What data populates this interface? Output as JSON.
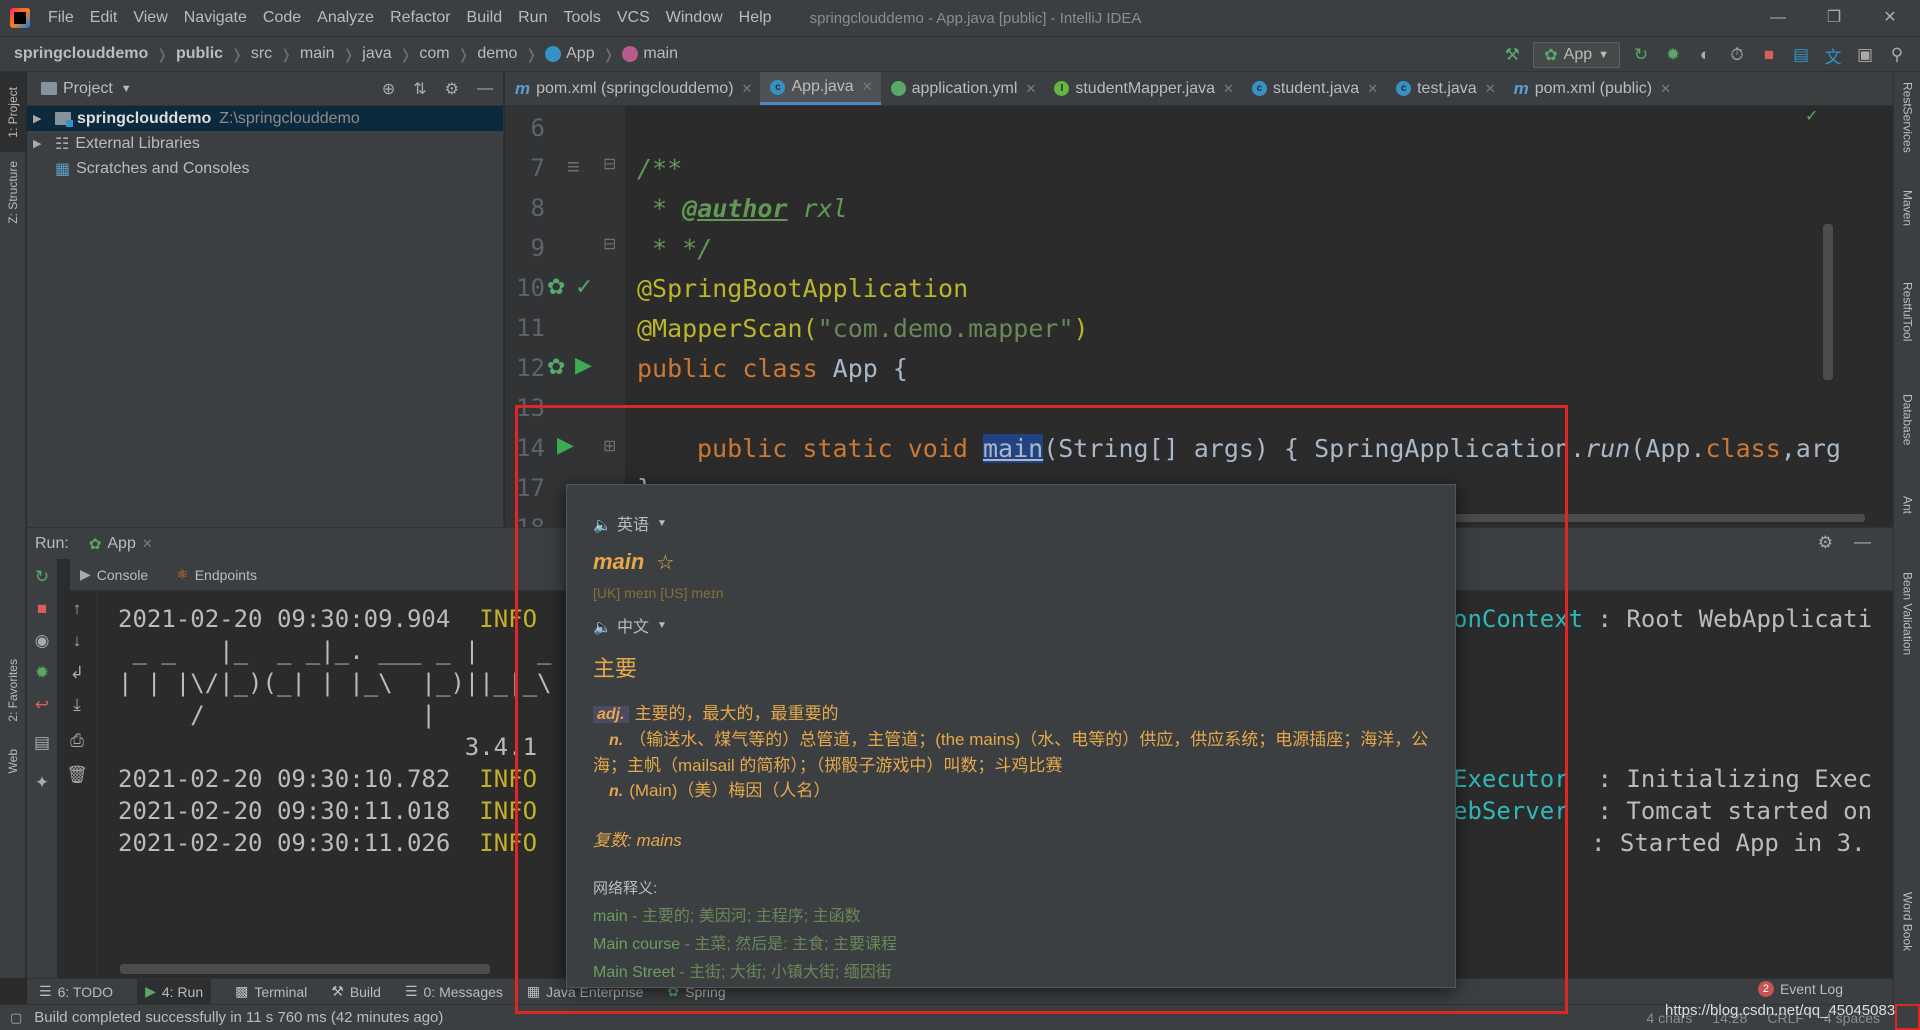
{
  "menubar": {
    "items": [
      "File",
      "Edit",
      "View",
      "Navigate",
      "Code",
      "Analyze",
      "Refactor",
      "Build",
      "Run",
      "Tools",
      "VCS",
      "Window",
      "Help"
    ],
    "title": "springclouddemo - App.java [public] - IntelliJ IDEA"
  },
  "breadcrumb": [
    "springclouddemo",
    "public",
    "src",
    "main",
    "java",
    "com",
    "demo",
    "App",
    "main"
  ],
  "toolbar": {
    "run_config": "App"
  },
  "left_stripe": [
    "1: Project",
    "Z: Structure",
    "2: Favorites",
    "Web"
  ],
  "right_stripe": [
    "RestServices",
    "Maven",
    "RestfulTool",
    "Database",
    "Ant",
    "Bean Validation",
    "Word Book"
  ],
  "project": {
    "title": "Project",
    "tree": [
      {
        "label": "springclouddemo",
        "path": "Z:\\springclouddemo"
      },
      {
        "label": "External Libraries"
      },
      {
        "label": "Scratches and Consoles"
      }
    ]
  },
  "editor_tabs": [
    "pom.xml (springclouddemo)",
    "App.java",
    "application.yml",
    "studentMapper.java",
    "student.java",
    "test.java",
    "pom.xml (public)"
  ],
  "code": {
    "line_numbers": [
      "6",
      "7",
      "8",
      "9",
      "10",
      "11",
      "12",
      "13",
      "14",
      "17",
      "18"
    ],
    "l7": "/**",
    "l8_a": " * ",
    "l8_tag": "@author",
    "l8_b": " rxl",
    "l9": " * */",
    "l10": "@SpringBootApplication",
    "l11_a": "@MapperScan(",
    "l11_str": "\"com.demo.mapper\"",
    "l11_b": ")",
    "l12_kw": "public class ",
    "l12_b": "App {",
    "l14_kw": "public static void ",
    "l14_name": "main",
    "l14_a": "(String[] args) { SpringApplication.",
    "l14_run": "run",
    "l14_b": "(App.",
    "l14_cls": "class",
    "l14_c": ",arg",
    "l17": "}"
  },
  "run_panel": {
    "label": "Run:",
    "tab": "App",
    "subtabs": [
      "Console",
      "Endpoints"
    ],
    "lines": [
      {
        "ts": "2021-02-20 09:30:09.904",
        "level": "INFO",
        "cls": "onContext",
        "msg": ": Root WebApplicati"
      },
      {
        "text": " _ _   |_  _ _|_. ___ _ |    _"
      },
      {
        "text": "| | |\\/|_)(_| | |_\\  |_)||_|_\\"
      },
      {
        "text": "     /               |"
      },
      {
        "text": "                        3.4.1"
      },
      {
        "ts": "2021-02-20 09:30:10.782",
        "level": "INFO",
        "cls": "Executor",
        "msg": ": Initializing Exec"
      },
      {
        "ts": "2021-02-20 09:30:11.018",
        "level": "INFO",
        "cls": "ebServer",
        "msg": ": Tomcat started on"
      },
      {
        "ts": "2021-02-20 09:30:11.026",
        "level": "INFO",
        "cls": "",
        "msg": ": Started App in 3."
      }
    ]
  },
  "bottom_tabs": [
    "6: TODO",
    "4: Run",
    "Terminal",
    "Build",
    "0: Messages",
    "Java Enterprise",
    "Spring"
  ],
  "event_log": {
    "count": "2",
    "label": "Event Log"
  },
  "status": {
    "message": "Build completed successfully in 11 s 760 ms (42 minutes ago)",
    "chars": "4 chars",
    "pos": "14:28",
    "eol": "CRLF",
    "indent": "4 spaces"
  },
  "watermark": "https://blog.csdn.net/qq_45045083",
  "popup": {
    "src_lang": "英语",
    "word": "main",
    "phonetic": "[UK] meɪn    [US] meɪn",
    "tgt_lang": "中文",
    "translation": "主要",
    "defs": [
      {
        "pos": "adj.",
        "text": "主要的，最大的，最重要的"
      },
      {
        "pos": "n.",
        "text": "（输送水、煤气等的）总管道，主管道；(the mains)（水、电等的）供应，供应系统；电源插座；海洋，公海；主帆（mailsail 的简称）；（掷骰子游戏中）叫数；斗鸡比赛"
      },
      {
        "pos": "n.",
        "text": "(Main)（美）梅因（人名）"
      }
    ],
    "plural": "复数: mains",
    "net_label": "网络释义:",
    "net": [
      {
        "term": "main",
        "gloss": " - 主要的; 美因河; 主程序; 主函数"
      },
      {
        "term": "Main course",
        "gloss": " - 主菜; 然后是: 主食; 主要课程"
      },
      {
        "term": "Main Street",
        "gloss": " - 主街; 大街; 小镇大街; 缅因街"
      }
    ]
  }
}
